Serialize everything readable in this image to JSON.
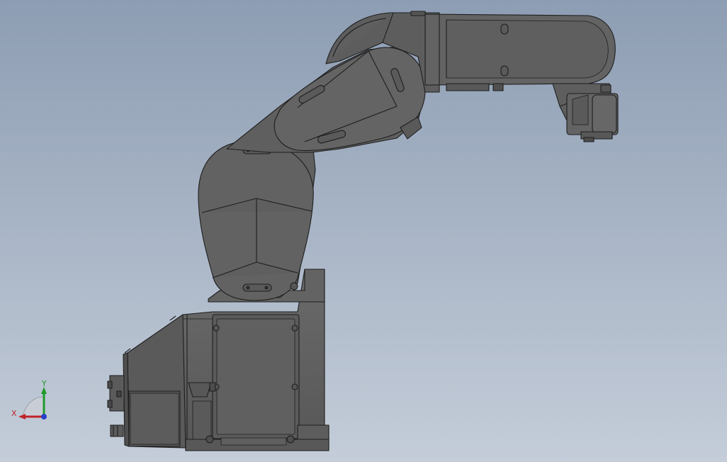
{
  "viewport": {
    "background_top": "#8d9db3",
    "background_bottom": "#c4cdd9",
    "model_fill": "#5e5e5e",
    "model_edge": "#1e1e1e"
  },
  "triad": {
    "x_label": "X",
    "y_label": "Y",
    "x_color": "#c0242a",
    "y_color": "#1f9a2a",
    "z_color": "#2a3fc8"
  }
}
